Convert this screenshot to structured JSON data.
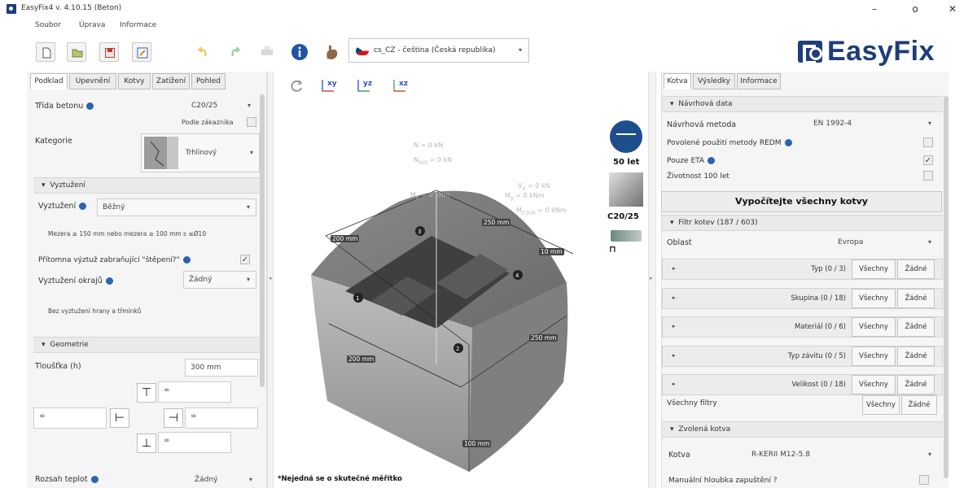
{
  "window": {
    "title": "EasyFix4 v. 4.10.15 (Beton)",
    "minimize": "–",
    "maximize": "o",
    "close": "✕"
  },
  "menu": [
    "Soubor",
    "Úprava",
    "Informace"
  ],
  "toolbar": {
    "language": "cs_CZ - čeština (Česká republika)",
    "logo_text": "EasyFix"
  },
  "left": {
    "tabs": [
      "Podklad",
      "Upevnění",
      "Kotvy",
      "Zatížení",
      "Pohled"
    ],
    "concrete_class_label": "Třída betonu",
    "concrete_class_value": "C20/25",
    "per_customer": "Podle zákazníka",
    "category_label": "Kategorie",
    "category_value": "Trhlinový",
    "reinforcement_section": "Vyztužení",
    "reinforcement_label": "Vyztužení",
    "reinforcement_value": "Běžný",
    "reinforcement_note": "Mezera ≥ 150 mm nebo mezera ≥ 100 mm s ≤Ø10",
    "splitting_label": "Přítomna výztuž zabraňující \"štěpení?\"",
    "edge_reinf_label": "Vyztužení okrajů",
    "edge_reinf_value": "Žádný",
    "edge_note": "Bez vyztužení hrany a třmínků",
    "geometry_section": "Geometrie",
    "thickness_label": "Tloušťka (h)",
    "thickness_value": "300 mm",
    "geo_top": "∞",
    "geo_left": "∞",
    "geo_right": "∞",
    "geo_bottom": "∞",
    "temp_label": "Rozsah teplot",
    "temp_value": "Žádný"
  },
  "canvas": {
    "axes": [
      "xy",
      "yz",
      "xz"
    ],
    "load_n": "N = 0 kN",
    "load_nsus": "N",
    "load_nsus_sub": "sus",
    "load_nsus_val": " = 0 kN",
    "load_vy": "V",
    "load_vy_sub": "y",
    "load_vy_val": " = 0 kN",
    "load_mx": "M",
    "load_mx_sub": "x",
    "load_mx_val": " = 0 kNm",
    "load_my": "M",
    "load_my_sub": "y",
    "load_my_val": " = 0 kNm",
    "load_mzsus": "M",
    "load_mzsus_sub": "z,sus",
    "load_mzsus_val": " = 0 kNm",
    "dims": {
      "d200a": "200 mm",
      "d250a": "250 mm",
      "d10": "10 mm",
      "d200b": "200 mm",
      "d250b": "250 mm",
      "d100": "100 mm"
    },
    "anchors": [
      "1",
      "2",
      "3",
      "4"
    ],
    "scale_note": "*Nejedná se o skutečné měřítko"
  },
  "indicators": {
    "years": "50 let",
    "concrete": "C20/25",
    "anchor_glyph": "⊓"
  },
  "right": {
    "tabs": [
      "Kotva",
      "Výsledky",
      "Informace"
    ],
    "design_section": "Návrhová data",
    "method_label": "Návrhová metoda",
    "method_value": "EN 1992-4",
    "redm_label": "Povolené použití metody REDM",
    "eta_label": "Pouze ETA",
    "life_label": "Životnost 100 let",
    "calc_button": "Vypočítejte všechny kotvy",
    "filter_section": "Filtr kotev (187 / 603)",
    "area_label": "Oblast",
    "area_value": "Evropa",
    "filters": [
      {
        "name": "Typ (0 / 3)"
      },
      {
        "name": "Skupina (0 / 18)"
      },
      {
        "name": "Materiál (0 / 6)"
      },
      {
        "name": "Typ závitu (0 / 5)"
      },
      {
        "name": "Velikost (0 / 18)"
      }
    ],
    "all_label": "Všechny",
    "none_label": "Žádné",
    "all_filters_label": "Všechny filtry",
    "selected_section": "Zvolená kotva",
    "anchor_label": "Kotva",
    "anchor_value": "R-KERII M12-5.8",
    "manual_depth_label": "Manuální hloubka zapuštění ?"
  },
  "colors": {
    "brand": "#1d3e7a",
    "info": "#2a64b2"
  }
}
